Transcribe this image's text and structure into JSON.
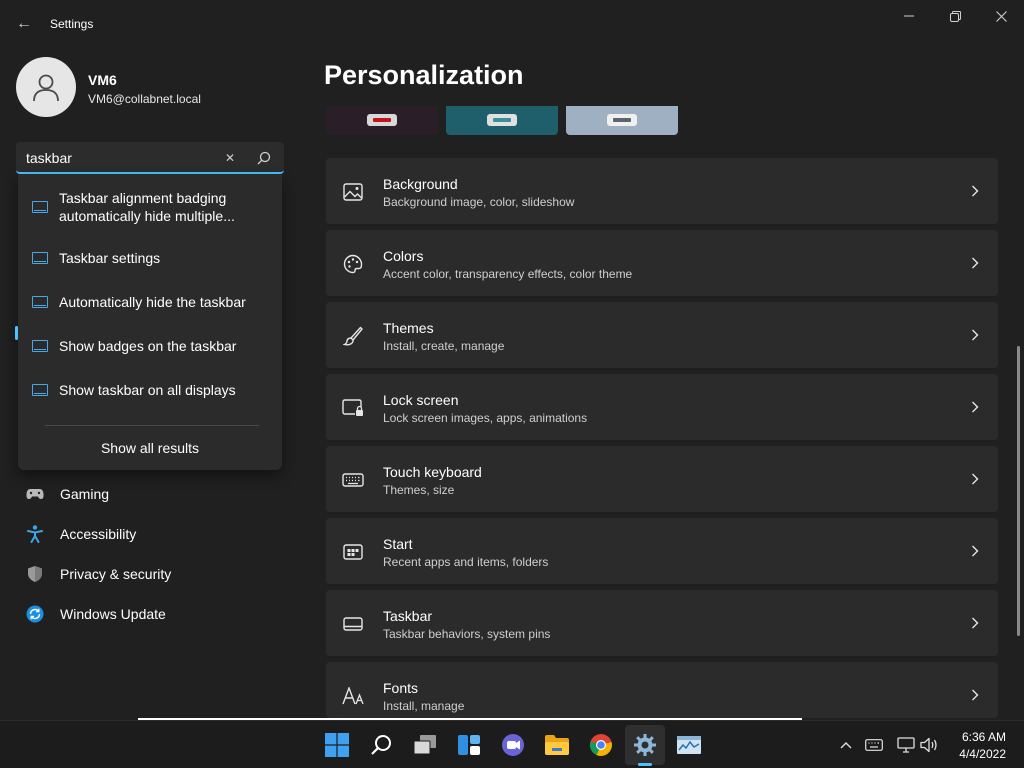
{
  "window": {
    "title": "Settings",
    "back_glyph": "←",
    "minimize_glyph": "—",
    "maximize_glyph": "❐",
    "close_glyph": "✕"
  },
  "profile": {
    "name": "VM6",
    "email": "VM6@collabnet.local"
  },
  "search": {
    "value": "taskbar",
    "clear_glyph": "✕",
    "accent": "#4cc2ff"
  },
  "suggestions": {
    "items": [
      {
        "label_line1": "Taskbar alignment badging",
        "label_line2": "automatically hide multiple...",
        "icon": "taskbar-icon"
      },
      {
        "label": "Taskbar settings",
        "icon": "taskbar-icon"
      },
      {
        "label": "Automatically hide the taskbar",
        "icon": "taskbar-icon"
      },
      {
        "label": "Show badges on the taskbar",
        "icon": "taskbar-icon"
      },
      {
        "label": "Show taskbar on all displays",
        "icon": "taskbar-icon"
      }
    ],
    "show_all": "Show all results"
  },
  "sidebar": {
    "items": [
      {
        "label": "Gaming",
        "icon": "gamepad-icon"
      },
      {
        "label": "Accessibility",
        "icon": "accessibility-icon"
      },
      {
        "label": "Privacy & security",
        "icon": "shield-icon"
      },
      {
        "label": "Windows Update",
        "icon": "update-icon"
      }
    ]
  },
  "main": {
    "title": "Personalization",
    "theme_thumbs": [
      {
        "bg": "#2a1f28",
        "pill": "#d8d8d8",
        "pill_inner": "#c4141c"
      },
      {
        "bg": "#1f5f6b",
        "pill": "#e0e0e0",
        "pill_inner": "#3a8f99"
      },
      {
        "bg": "#9fb0c3",
        "pill": "#f0f0f0",
        "pill_inner": "#5c6470"
      }
    ],
    "cards": [
      {
        "title": "Background",
        "subtitle": "Background image, color, slideshow",
        "icon": "image-icon"
      },
      {
        "title": "Colors",
        "subtitle": "Accent color, transparency effects, color theme",
        "icon": "palette-icon"
      },
      {
        "title": "Themes",
        "subtitle": "Install, create, manage",
        "icon": "brush-icon"
      },
      {
        "title": "Lock screen",
        "subtitle": "Lock screen images, apps, animations",
        "icon": "lock-screen-icon"
      },
      {
        "title": "Touch keyboard",
        "subtitle": "Themes, size",
        "icon": "keyboard-icon"
      },
      {
        "title": "Start",
        "subtitle": "Recent apps and items, folders",
        "icon": "start-icon"
      },
      {
        "title": "Taskbar",
        "subtitle": "Taskbar behaviors, system pins",
        "icon": "taskbar-icon"
      },
      {
        "title": "Fonts",
        "subtitle": "Install, manage",
        "icon": "fonts-icon"
      }
    ]
  },
  "taskbar": {
    "apps": [
      {
        "name": "windows-start-icon"
      },
      {
        "name": "search-icon"
      },
      {
        "name": "task-view-icon"
      },
      {
        "name": "widgets-icon"
      },
      {
        "name": "teams-chat-icon"
      },
      {
        "name": "file-explorer-icon"
      },
      {
        "name": "chrome-icon"
      },
      {
        "name": "settings-gear-icon"
      },
      {
        "name": "performance-monitor-icon"
      }
    ],
    "tray": {
      "chevron_glyph": "⌃",
      "time": "6:36 AM",
      "date": "4/4/2022"
    }
  }
}
